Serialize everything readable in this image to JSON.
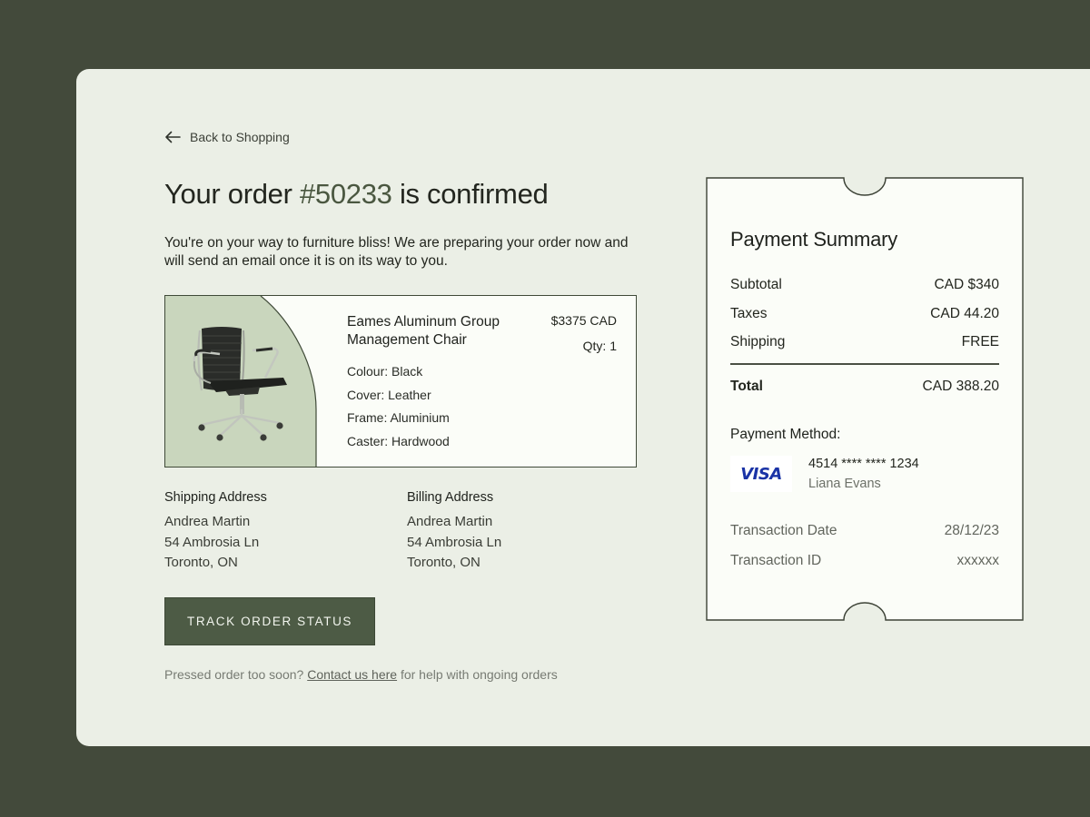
{
  "nav": {
    "back_label": "Back to Shopping"
  },
  "order": {
    "title_prefix": "Your order",
    "order_number": "#50233",
    "title_suffix": "is confirmed",
    "intro": "You're on your way to furniture bliss! We are preparing your order now and will send an email once it is on its way to you."
  },
  "product": {
    "name": "Eames Aluminum Group Management Chair",
    "price": "$3375 CAD",
    "qty": "Qty: 1",
    "attributes": [
      "Colour: Black",
      "Cover: Leather",
      "Frame: Aluminium",
      "Caster: Hardwood"
    ],
    "image_icon": "office-chair-image"
  },
  "shipping": {
    "heading": "Shipping Address",
    "lines": [
      "Andrea Martin",
      "54 Ambrosia Ln",
      "Toronto, ON"
    ]
  },
  "billing": {
    "heading": "Billing Address",
    "lines": [
      "Andrea Martin",
      "54 Ambrosia Ln",
      "Toronto, ON"
    ]
  },
  "actions": {
    "track_label": "TRACK ORDER STATUS"
  },
  "help": {
    "prefix": "Pressed order too soon?",
    "link": "Contact us here",
    "suffix": "for help with ongoing orders"
  },
  "summary": {
    "title": "Payment Summary",
    "rows": [
      {
        "label": "Subtotal",
        "value": "CAD $340"
      },
      {
        "label": "Taxes",
        "value": "CAD 44.20"
      },
      {
        "label": "Shipping",
        "value": "FREE"
      }
    ],
    "total": {
      "label": "Total",
      "value": "CAD 388.20"
    },
    "payment_method_label": "Payment Method:",
    "card": {
      "brand": "VISA",
      "number": "4514 **** **** 1234",
      "holder": "Liana Evans"
    },
    "transaction": [
      {
        "label": "Transaction Date",
        "value": "28/12/23"
      },
      {
        "label": "Transaction ID",
        "value": "xxxxxx"
      }
    ]
  },
  "colors": {
    "page_bg": "#434a3b",
    "card_bg": "#ebefe6",
    "accent": "#4d5b45",
    "image_bg": "#c9d6bd",
    "visa_blue": "#1a33a6"
  }
}
